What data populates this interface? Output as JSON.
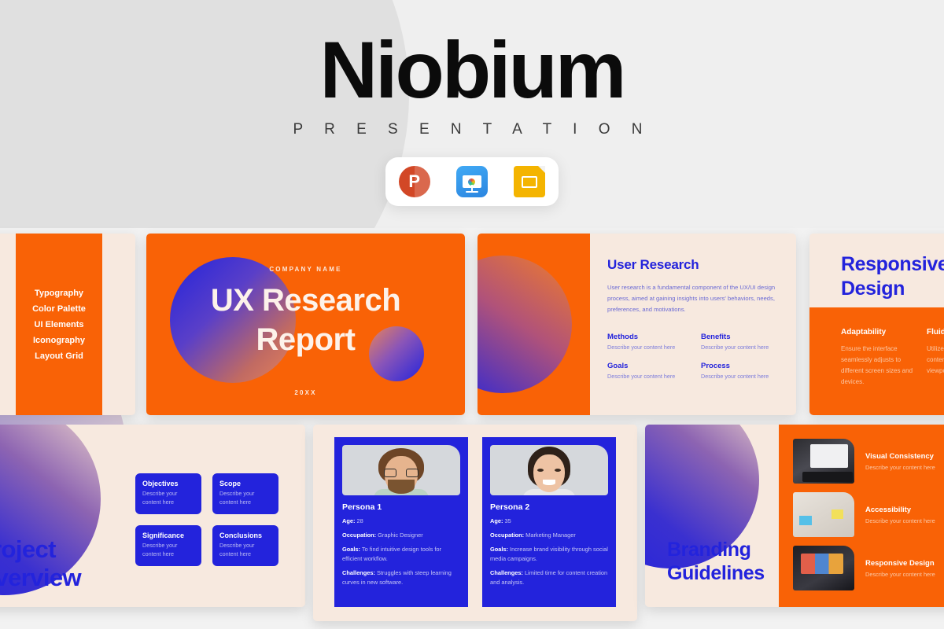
{
  "hero": {
    "title": "Niobium",
    "subtitle": "P R E S E N T A T I O N",
    "icons": [
      {
        "name": "powerpoint-icon",
        "glyph": "P"
      },
      {
        "name": "keynote-icon",
        "glyph": ""
      },
      {
        "name": "google-slides-icon",
        "glyph": ""
      }
    ]
  },
  "colors": {
    "orange": "#F96206",
    "blue": "#2323DC",
    "cream": "#F7E9DF",
    "page_bg": "#F2F2F2",
    "black": "#0B0B0B"
  },
  "slides": {
    "toc": {
      "items": [
        "Typography",
        "Color Palette",
        "UI Elements",
        "Iconography",
        "Layout Grid"
      ]
    },
    "cover": {
      "company": "COMPANY NAME",
      "title_line1": "UX Research",
      "title_line2": "Report",
      "year": "20XX"
    },
    "user_research": {
      "heading": "User Research",
      "paragraph": "User research is a fundamental component of the UX/UI design process, aimed at gaining insights into users' behaviors, needs, preferences, and motivations.",
      "items": [
        {
          "title": "Methods",
          "desc": "Describe your content here"
        },
        {
          "title": "Benefits",
          "desc": "Describe your content here"
        },
        {
          "title": "Goals",
          "desc": "Describe your content here"
        },
        {
          "title": "Process",
          "desc": "Describe your content here"
        }
      ]
    },
    "responsive": {
      "title_line1": "Responsive",
      "title_line2": "Design",
      "columns": [
        {
          "title": "Adaptability",
          "desc": "Ensure the interface seamlessly adjusts to different screen sizes and devices."
        },
        {
          "title": "Fluidity",
          "desc": "Utilize media queries content usability viewports"
        }
      ]
    },
    "project_overview": {
      "title_line1": "Project",
      "title_line2": "Overview",
      "cards": [
        {
          "title": "Objectives",
          "desc": "Describe your content here"
        },
        {
          "title": "Scope",
          "desc": "Describe your content here"
        },
        {
          "title": "Significance",
          "desc": "Describe your content here"
        },
        {
          "title": "Conclusions",
          "desc": "Describe your content here"
        }
      ]
    },
    "personas": [
      {
        "name": "Persona 1",
        "age_label": "Age:",
        "age": " 28",
        "occupation_label": "Occupation:",
        "occupation": " Graphic Designer",
        "goals_label": "Goals:",
        "goals": " To find intuitive design tools for efficient workflow.",
        "challenges_label": "Challenges:",
        "challenges": " Struggles with steep learning curves in new software."
      },
      {
        "name": "Persona 2",
        "age_label": "Age:",
        "age": " 35",
        "occupation_label": "Occupation:",
        "occupation": " Marketing Manager",
        "goals_label": "Goals:",
        "goals": " Increase brand visibility through social media campaigns.",
        "challenges_label": "Challenges:",
        "challenges": " Limited time for content creation and analysis."
      }
    ],
    "branding": {
      "title_line1": "Branding",
      "title_line2": "Guidelines",
      "rows": [
        {
          "title": "Visual Consistency",
          "desc": "Describe your content here"
        },
        {
          "title": "Accessibility",
          "desc": "Describe your content here"
        },
        {
          "title": "Responsive Design",
          "desc": "Describe your content here"
        }
      ]
    }
  }
}
